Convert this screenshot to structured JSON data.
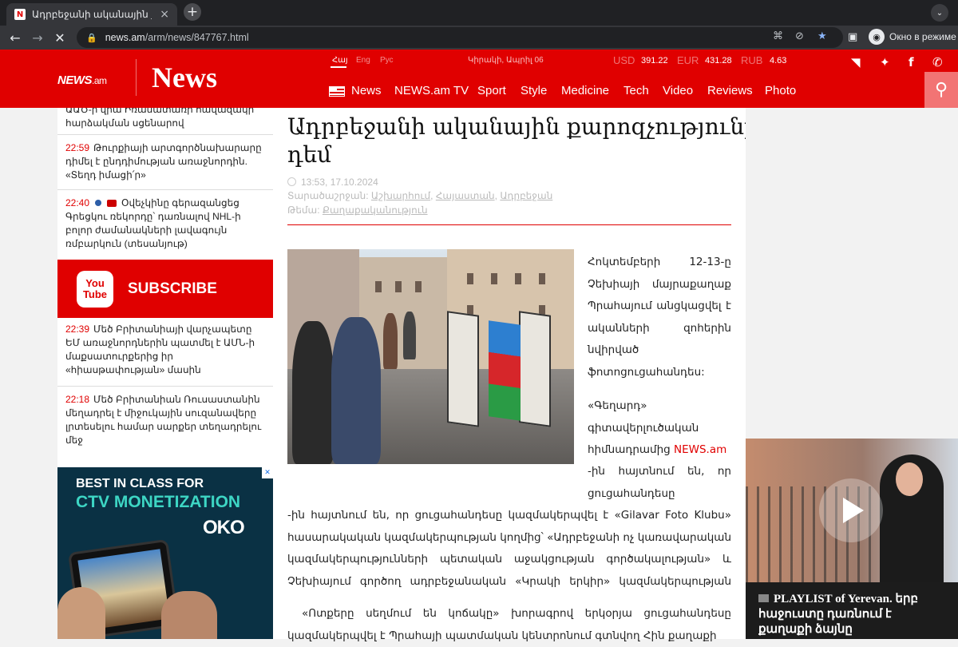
{
  "browser": {
    "tab_title": "Ադրբեջանի ականային քարոզչ...",
    "tab_close": "×",
    "new_tab": "+",
    "tab_menu": "⌄",
    "url_host": "news.am",
    "url_path": "/arm/news/847767.html",
    "incognito_label": "Окно в режиме и",
    "icons": [
      "back-icon",
      "forward-icon",
      "stop-icon",
      "lock-icon",
      "translate-icon",
      "eye-off-icon",
      "star-icon",
      "side-panel-icon",
      "incognito-icon"
    ]
  },
  "header": {
    "logo_small_main": "NEWS",
    "logo_small_suffix": ".am",
    "logo_big": "News",
    "langs": [
      "Հայ",
      "Eng",
      "Рус"
    ],
    "date_label": "Կիրակի, Ապրիլ 06",
    "currencies": [
      {
        "code": "USD",
        "value": "391.22"
      },
      {
        "code": "EUR",
        "value": "431.28"
      },
      {
        "code": "RUB",
        "value": "4.63"
      }
    ],
    "menu": [
      "News",
      "NEWS.am TV",
      "Sport",
      "Style",
      "Medicine",
      "Tech",
      "Video",
      "Reviews",
      "Photo"
    ],
    "social_icons": [
      "rss-icon",
      "twitter-icon",
      "facebook-icon",
      "viber-icon"
    ],
    "brand_color": "#e00000"
  },
  "sidebar": {
    "items": [
      {
        "time": "",
        "text": "ԱԱԾ-ի վրա Իռանատառի հավազակի հարձակման սցենարով"
      },
      {
        "time": "22:59",
        "text": "Թուրքիայի արտգործնախարարը դիմել է ընդդիմության առաջնորդին. «Տեղդ իմացի՛ր»"
      },
      {
        "time": "22:40",
        "text": "Օվեչկինը գերազանցեց Գրեցկու ռեկորդը՝ դառնալով NHL-ի բոլոր ժամանակների լավագույն ռմբարկուն (տեսանյութ)"
      },
      {
        "time": "22:39",
        "text": "Մեծ Բրիտանիայի վարչապետը ԵՄ առաջնորդներին պատմել է ԱՄՆ-ի մաքսատուրքերից իր «հիասթափության» մասին"
      },
      {
        "time": "22:18",
        "text": "Մեծ Բրիտանիան Ռուսաստանին մեղադրել է միջուկային սուզանավերը լրտեսելու համար սարքեր տեղադրելու մեջ"
      }
    ],
    "subscribe": {
      "logo": "You Tube",
      "label": "SUBSCRIBE"
    },
    "ad": {
      "line1": "BEST IN CLASS FOR",
      "line2": "CTV MONETIZATION",
      "brand": "OKO"
    }
  },
  "article": {
    "title": "Ադրբեջանի ականային քարոզչությունը Հայաստանի դեմ",
    "datetime": "13:53, 17.10.2024",
    "region_label": "Տարածաշրջան:",
    "regions": [
      "Աշխարհում",
      "Հայաստան",
      "Ադրբեջան"
    ],
    "topic_label": "Թեմա:",
    "topic": "Քաղաքականություն",
    "paragraphs": [
      "Հոկտեմբերի 12-13-ը Չեխիայի մայրաքաղաք Պրահայում անցկացվել է ականների զոհերին նվիրված ֆոտոցուցահանդես:",
      "«Գեղարդ» գիտավերլուծական հիմնադրամից",
      "-ին հայտնում են, որ ցուցահանդեսը կազմակերպվել է «Gilavar Foto Klubu» հասարակական կազմակերպության կողմից՝ «Ադրբեջանի ոչ կառավարական կազմակերպությունների պետական աջակցության գործակալության» և Չեխիայում գործող ադրբեջանական «Կրակի երկիր» կազմակերպության ֆինանսական աջակցությամբ:",
      "«Ոտքերը սեղմում են կոճակը» խորագրով երկօրյա ցուցահանդեսը կազմակերպվել է Պրահայի պատմական կենտրոնում գտնվող Հին քաղաքի"
    ],
    "news_am_link": "NEWS.am",
    "photo_alt": "photo-exhibition-prague"
  },
  "video": {
    "caption": "PLAYLIST of Yerevan. երբ հաջուստը դառնում է քաղաքի ձայնը"
  }
}
